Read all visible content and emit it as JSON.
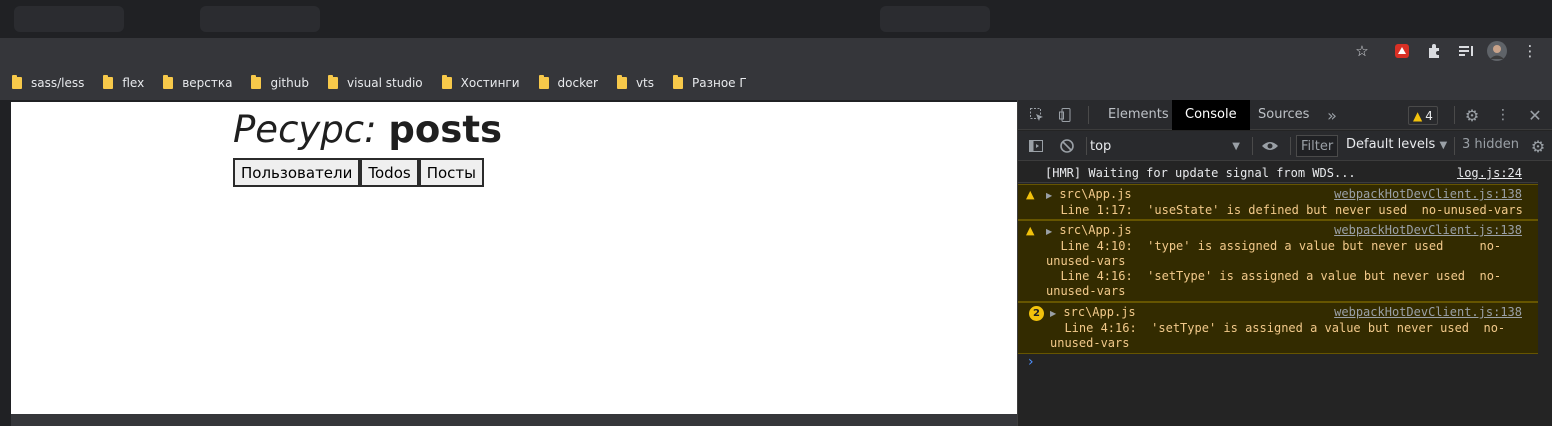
{
  "browser": {
    "bookmarks": [
      {
        "label": "sass/less"
      },
      {
        "label": "flex"
      },
      {
        "label": "верстка"
      },
      {
        "label": "github"
      },
      {
        "label": "visual studio"
      },
      {
        "label": "Хостинги"
      },
      {
        "label": "docker"
      },
      {
        "label": "vts"
      },
      {
        "label": "Разное Г"
      }
    ],
    "toolbar_icons": [
      "star-icon",
      "extension-badge-icon",
      "puzzle-icon",
      "media-queue-icon",
      "profile-avatar",
      "more-vert-icon"
    ]
  },
  "page": {
    "title_label": "Ресурс:",
    "title_resource": "posts",
    "buttons": [
      {
        "label": "Пользователи"
      },
      {
        "label": "Todos"
      },
      {
        "label": "Посты"
      }
    ]
  },
  "devtools": {
    "tabs": [
      {
        "label": "Elements",
        "active": false
      },
      {
        "label": "Console",
        "active": true
      },
      {
        "label": "Sources",
        "active": false
      }
    ],
    "more_tabs": "»",
    "warnings_count": "4",
    "context": "top",
    "filter_placeholder": "Filter",
    "levels": "Default levels",
    "hidden": "3 hidden",
    "messages": [
      {
        "type": "info",
        "lines": [
          "[HMR] Waiting for update signal from WDS..."
        ],
        "source": "log.js:24"
      },
      {
        "type": "warning",
        "header": "src\\App.js",
        "lines": [
          "  Line 1:17:  'useState' is defined but never used  no-unused-vars"
        ],
        "source": "webpackHotDevClient.js:138"
      },
      {
        "type": "warning",
        "header": "src\\App.js",
        "lines": [
          "  Line 4:10:  'type' is assigned a value but never used     no-",
          "unused-vars",
          "  Line 4:16:  'setType' is assigned a value but never used  no-",
          "unused-vars"
        ],
        "source": "webpackHotDevClient.js:138"
      },
      {
        "type": "warning",
        "count": "2",
        "header": "src\\App.js",
        "lines": [
          "  Line 4:16:  'setType' is assigned a value but never used  no-",
          "unused-vars"
        ],
        "source": "webpackHotDevClient.js:138"
      }
    ],
    "prompt": "›"
  },
  "colors": {
    "warning_bg": "#332b00",
    "warning_text": "#f2c98a",
    "warning_icon": "#f2c20c",
    "active_tab_bg": "#000000"
  }
}
